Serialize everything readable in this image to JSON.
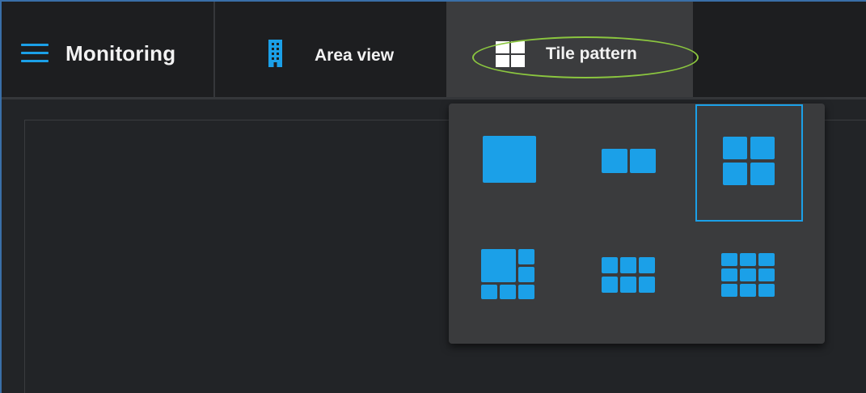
{
  "header": {
    "menu_icon": "hamburger-menu-icon",
    "title": "Monitoring",
    "tabs": [
      {
        "label": "Area view",
        "icon": "building-icon"
      },
      {
        "label": "Tile pattern",
        "icon": "tile-grid-icon",
        "active": true
      }
    ]
  },
  "tile_pattern_menu": {
    "options": [
      {
        "icon": "layout-1x1-icon",
        "selected": false
      },
      {
        "icon": "layout-2x1-icon",
        "selected": false
      },
      {
        "icon": "layout-2x2-icon",
        "selected": true
      },
      {
        "icon": "layout-1-plus-5-icon",
        "selected": false
      },
      {
        "icon": "layout-3x2-icon",
        "selected": false
      },
      {
        "icon": "layout-3x3-icon",
        "selected": false
      }
    ]
  },
  "colors": {
    "accent": "#1ba0e8",
    "highlight": "#8bc63f",
    "topbar": "#1d1e20",
    "active_tab": "#3b3c3e",
    "dropdown": "#3a3b3d",
    "content": "#222427"
  }
}
